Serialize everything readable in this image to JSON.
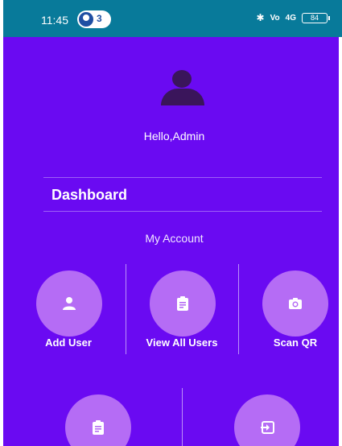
{
  "status_bar": {
    "time": "11:45",
    "notification_count": "3",
    "network": "Vo",
    "signal": "4G",
    "battery": "84"
  },
  "profile": {
    "greeting": "Hello,Admin",
    "icon": "person-icon"
  },
  "sections": {
    "dashboard_title": "Dashboard",
    "my_account_label": "My Account"
  },
  "actions": [
    {
      "label": "Add User",
      "icon": "person-icon"
    },
    {
      "label": "View All Users",
      "icon": "clipboard-icon"
    },
    {
      "label": "Scan QR",
      "icon": "camera-icon"
    },
    {
      "label": "",
      "icon": "clipboard-icon"
    },
    {
      "label": "",
      "icon": "logout-icon"
    }
  ],
  "colors": {
    "background": "#6a0af2",
    "status_bar": "#087a9a",
    "action_circle": "#b56cf5",
    "avatar": "#3a155b"
  }
}
